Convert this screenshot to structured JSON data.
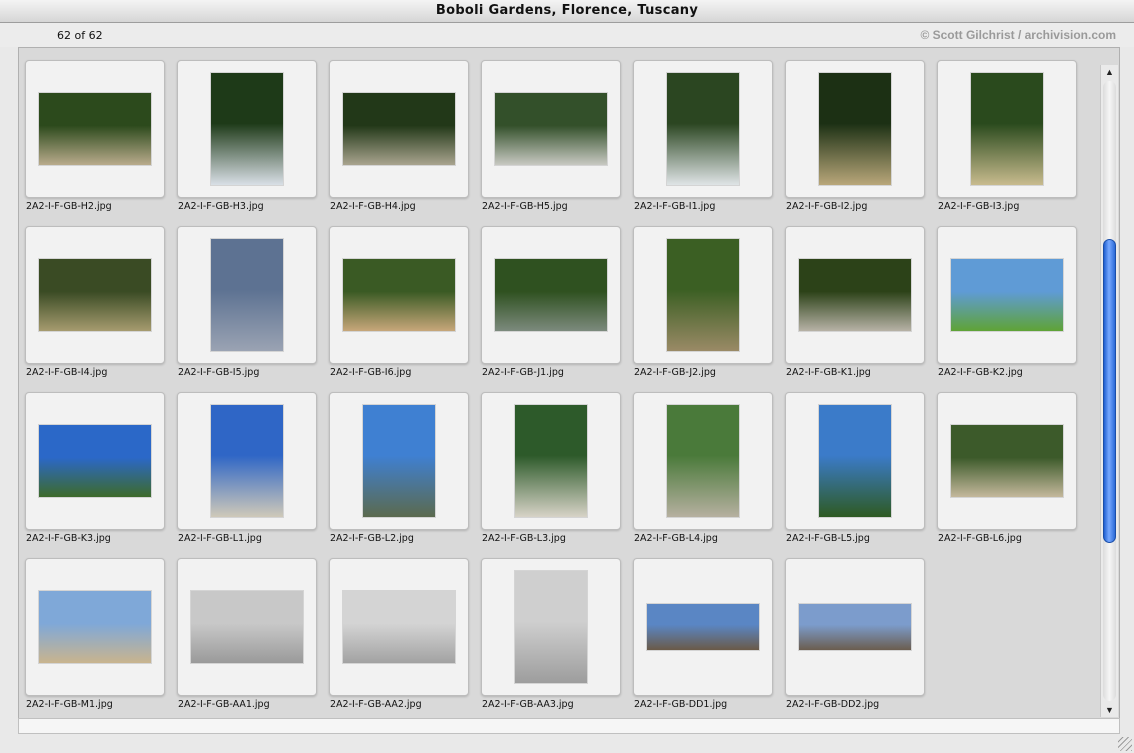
{
  "window": {
    "title": "Boboli Gardens, Florence, Tuscany"
  },
  "info": {
    "count": "62 of 62",
    "credit": "© Scott Gilchrist / archivision.com"
  },
  "scrollbar": {
    "position_fraction": 0.5
  },
  "slides": [
    {
      "file": "2A2-I-F-GB-H2.jpg",
      "c1": "#2c4a1c",
      "c2": "#b9ab8c",
      "orient": "landscape"
    },
    {
      "file": "2A2-I-F-GB-H3.jpg",
      "c1": "#1e3a18",
      "c2": "#d9dfe6",
      "orient": "portrait"
    },
    {
      "file": "2A2-I-F-GB-H4.jpg",
      "c1": "#223818",
      "c2": "#a9a48f",
      "orient": "landscape"
    },
    {
      "file": "2A2-I-F-GB-H5.jpg",
      "c1": "#33502a",
      "c2": "#c8c9c2",
      "orient": "landscape"
    },
    {
      "file": "2A2-I-F-GB-I1.jpg",
      "c1": "#2b4621",
      "c2": "#dfe4e6",
      "orient": "portrait"
    },
    {
      "file": "2A2-I-F-GB-I2.jpg",
      "c1": "#1c3014",
      "c2": "#b9a77a",
      "orient": "portrait"
    },
    {
      "file": "2A2-I-F-GB-I3.jpg",
      "c1": "#2a4a1d",
      "c2": "#c8bb8e",
      "orient": "portrait"
    },
    {
      "file": "2A2-I-F-GB-I4.jpg",
      "c1": "#3a4b24",
      "c2": "#a69b6f",
      "orient": "landscape"
    },
    {
      "file": "2A2-I-F-GB-I5.jpg",
      "c1": "#5d7292",
      "c2": "#9aa3b3",
      "orient": "portrait"
    },
    {
      "file": "2A2-I-F-GB-I6.jpg",
      "c1": "#3a5a24",
      "c2": "#c7a77a",
      "orient": "landscape"
    },
    {
      "file": "2A2-I-F-GB-J1.jpg",
      "c1": "#2f5120",
      "c2": "#7c8a7d",
      "orient": "landscape"
    },
    {
      "file": "2A2-I-F-GB-J2.jpg",
      "c1": "#3b5f23",
      "c2": "#9a8a66",
      "orient": "portrait"
    },
    {
      "file": "2A2-I-F-GB-K1.jpg",
      "c1": "#2c4218",
      "c2": "#b7b2a6",
      "orient": "landscape"
    },
    {
      "file": "2A2-I-F-GB-K2.jpg",
      "c1": "#5f9bd6",
      "c2": "#5fa336",
      "orient": "landscape"
    },
    {
      "file": "2A2-I-F-GB-K3.jpg",
      "c1": "#2b68c8",
      "c2": "#3d6a2a",
      "orient": "landscape"
    },
    {
      "file": "2A2-I-F-GB-L1.jpg",
      "c1": "#2f66c6",
      "c2": "#cfc9b9",
      "orient": "portrait"
    },
    {
      "file": "2A2-I-F-GB-L2.jpg",
      "c1": "#3f80d2",
      "c2": "#5b6a4e",
      "orient": "portrait"
    },
    {
      "file": "2A2-I-F-GB-L3.jpg",
      "c1": "#2d5a2a",
      "c2": "#d7d3c7",
      "orient": "portrait"
    },
    {
      "file": "2A2-I-F-GB-L4.jpg",
      "c1": "#4a7a3a",
      "c2": "#b6b0a0",
      "orient": "portrait"
    },
    {
      "file": "2A2-I-F-GB-L5.jpg",
      "c1": "#3b7bc9",
      "c2": "#2e5a22",
      "orient": "portrait"
    },
    {
      "file": "2A2-I-F-GB-L6.jpg",
      "c1": "#3c5a2a",
      "c2": "#c4b89c",
      "orient": "landscape"
    },
    {
      "file": "2A2-I-F-GB-M1.jpg",
      "c1": "#7fa8d8",
      "c2": "#c9b48e",
      "orient": "landscape"
    },
    {
      "file": "2A2-I-F-GB-AA1.jpg",
      "c1": "#c8c8c8",
      "c2": "#9a9a9a",
      "orient": "landscape"
    },
    {
      "file": "2A2-I-F-GB-AA2.jpg",
      "c1": "#d4d4d4",
      "c2": "#a2a2a2",
      "orient": "landscape"
    },
    {
      "file": "2A2-I-F-GB-AA3.jpg",
      "c1": "#cfcfcf",
      "c2": "#9d9d9d",
      "orient": "portrait"
    },
    {
      "file": "2A2-I-F-GB-DD1.jpg",
      "c1": "#5a86c4",
      "c2": "#6a5a48",
      "orient": "landscape-wide"
    },
    {
      "file": "2A2-I-F-GB-DD2.jpg",
      "c1": "#7c9ccc",
      "c2": "#6b5d4f",
      "orient": "landscape-wide"
    }
  ]
}
